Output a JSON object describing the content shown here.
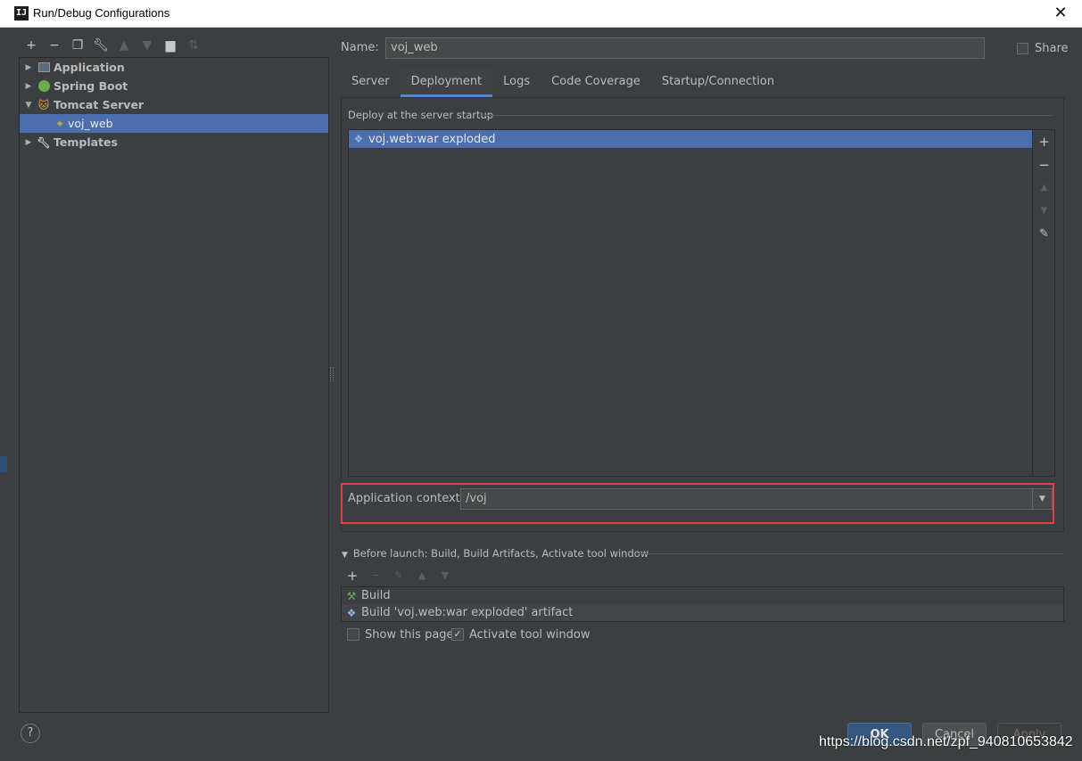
{
  "window": {
    "title": "Run/Debug Configurations",
    "app_icon": "IJ"
  },
  "left_toolbar": {
    "icons": [
      "add-icon",
      "remove-icon",
      "copy-icon",
      "wrench-icon",
      "move-up-icon",
      "move-down-icon",
      "folder-icon",
      "sort-icon"
    ]
  },
  "tree": {
    "items": [
      {
        "label": "Application",
        "icon": "application-icon"
      },
      {
        "label": "Spring Boot",
        "icon": "spring-boot-icon"
      },
      {
        "label": "Tomcat Server",
        "icon": "tomcat-icon"
      },
      {
        "label": "voj_web",
        "icon": "tomcat-config-icon"
      },
      {
        "label": "Templates",
        "icon": "wrench-icon"
      }
    ]
  },
  "form": {
    "name_label": "Name:",
    "name_value": "voj_web",
    "share_label": "Share"
  },
  "tabs": [
    "Server",
    "Deployment",
    "Logs",
    "Code Coverage",
    "Startup/Connection"
  ],
  "active_tab": "Deployment",
  "deploy": {
    "group_title": "Deploy at the server startup",
    "items": [
      "voj.web:war exploded"
    ]
  },
  "context": {
    "label": "Application context:",
    "value": "/voj"
  },
  "before_launch": {
    "title": "Before launch: Build, Build Artifacts, Activate tool window",
    "tasks": [
      "Build",
      "Build 'voj.web:war exploded' artifact"
    ],
    "show_page_label": "Show this page",
    "activate_label": "Activate tool window"
  },
  "buttons": {
    "ok": "OK",
    "cancel": "Cancel",
    "apply": "Apply"
  },
  "help": "?",
  "watermark": "https://blog.csdn.net/zpf_940810653842",
  "colors": {
    "selection": "#4b6eaf",
    "highlight_border": "#e0403e",
    "accent_tab": "#4a88c7",
    "background": "#3c3f41"
  }
}
